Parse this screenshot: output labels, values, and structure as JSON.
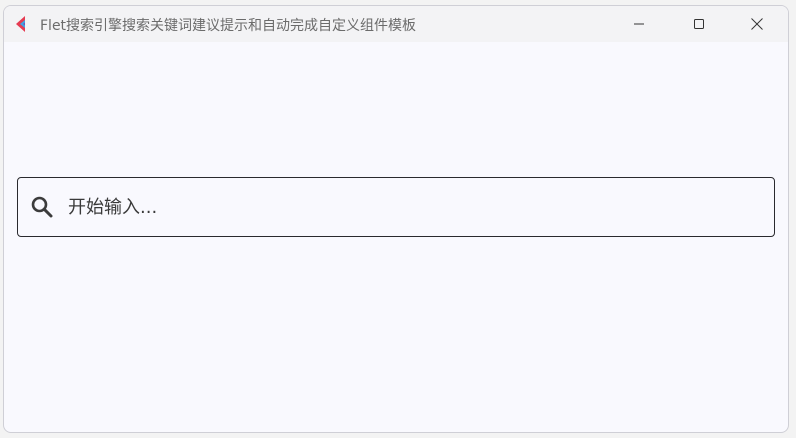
{
  "window": {
    "title": "Flet搜索引擎搜索关键词建议提示和自动完成自定义组件模板"
  },
  "icons": {
    "app": "flet-logo-icon",
    "minimize": "minimize-icon",
    "maximize": "maximize-icon",
    "close": "close-icon",
    "search": "search-icon"
  },
  "search": {
    "value": "",
    "placeholder": "开始输入..."
  },
  "colors": {
    "window_bg": "#f9f9fe",
    "titlebar_bg": "#f3f3f5",
    "border": "#2a2a2e",
    "flet_red": "#e53b52",
    "flet_blue": "#3ba5e5"
  }
}
